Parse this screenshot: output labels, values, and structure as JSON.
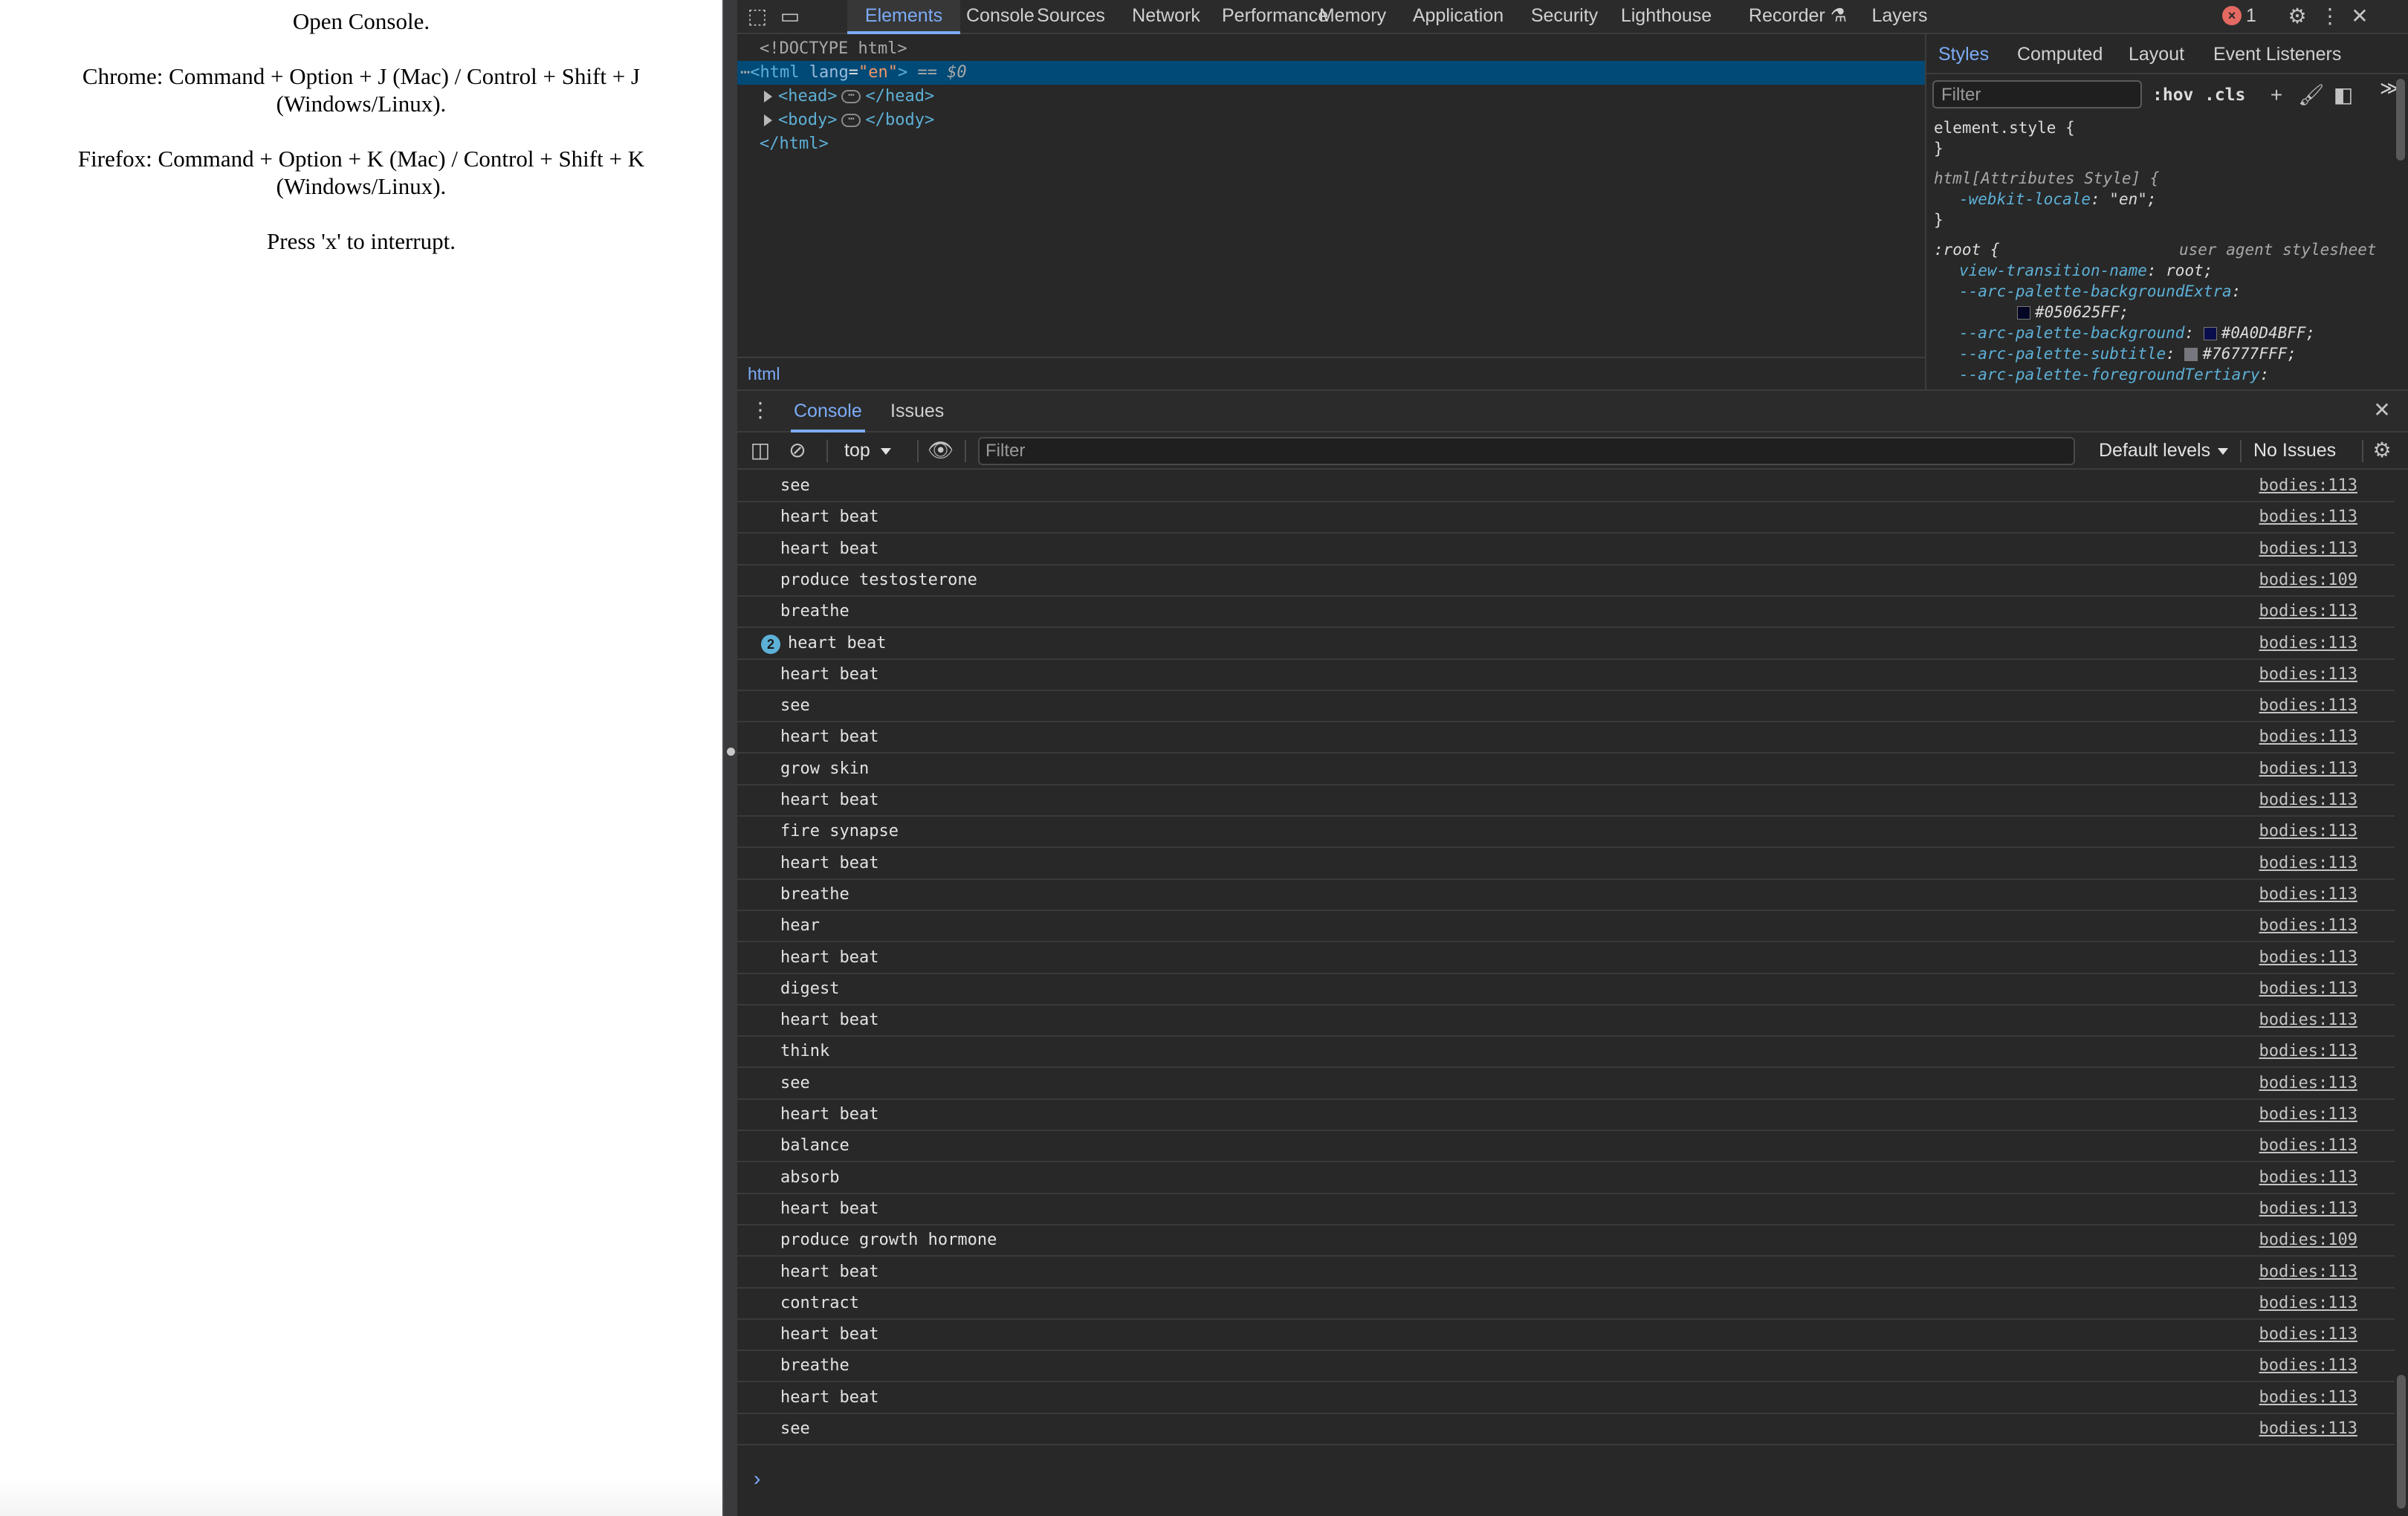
{
  "page": {
    "lines": [
      "Open Console.",
      "Chrome: Command + Option + J (Mac) / Control + Shift + J (Windows/Linux).",
      "Firefox: Command + Option + K (Mac) / Control + Shift + K (Windows/Linux).",
      "Press 'x' to interrupt."
    ]
  },
  "devtools": {
    "main_tabs": [
      {
        "label": "Elements",
        "active": true
      },
      {
        "label": "Console"
      },
      {
        "label": "Sources"
      },
      {
        "label": "Network"
      },
      {
        "label": "Performance"
      },
      {
        "label": "Memory"
      },
      {
        "label": "Application"
      },
      {
        "label": "Security"
      },
      {
        "label": "Lighthouse"
      },
      {
        "label": "Recorder"
      },
      {
        "label": "Layers"
      }
    ],
    "error_count": "1",
    "icons": {
      "inspect": "inspect-element-icon",
      "device": "device-toolbar-icon",
      "settings": "gear-icon",
      "more": "kebab-menu-icon",
      "close": "close-icon",
      "recorder": "flask-icon"
    },
    "dom": {
      "doctype": "<!DOCTYPE html>",
      "html_open_tag": "<html",
      "attr_name": "lang",
      "attr_value": "\"en\"",
      "html_close_bracket": ">",
      "selected_marker": "== $0",
      "head_open": "<head>",
      "head_close": "</head>",
      "body_open": "<body>",
      "body_close": "</body>",
      "html_close": "</html>",
      "ellipsis": "⋯",
      "dots": "⋯"
    },
    "breadcrumb": "html",
    "styles": {
      "tabs": [
        {
          "label": "Styles",
          "active": true
        },
        {
          "label": "Computed"
        },
        {
          "label": "Layout"
        },
        {
          "label": "Event Listeners"
        }
      ],
      "more_tabs": "≫",
      "filter_placeholder": "Filter",
      "hov": ":hov",
      "cls": ".cls",
      "rules": {
        "element_style": "element.style {",
        "close_brace": "}",
        "attr_selector": "html[Attributes Style] {",
        "locale_prop": "-webkit-locale",
        "locale_val": ": \"en\";",
        "root_selector": ":root {",
        "ua_label": "user agent stylesheet",
        "vt_prop": "view-transition-name",
        "vt_val": ": root;",
        "bg_extra_prop": "--arc-palette-backgroundExtra",
        "bg_extra_val": "#050625FF;",
        "bg_extra_color": "#050625",
        "bg_prop": "--arc-palette-background",
        "bg_val": "#0A0D4BFF;",
        "bg_color": "#0A0D4B",
        "subtitle_prop": "--arc-palette-subtitle",
        "subtitle_val": "#76777FFF;",
        "subtitle_color": "#76777F",
        "fg_tertiary_prop": "--arc-palette-foregroundTertiary",
        "colon": ":"
      }
    },
    "drawer": {
      "tabs": [
        {
          "label": "Console",
          "active": true
        },
        {
          "label": "Issues"
        }
      ],
      "context": "top",
      "filter_placeholder": "Filter",
      "levels": "Default levels",
      "no_issues": "No Issues"
    },
    "console_messages": [
      {
        "text": "see",
        "source": "bodies:113"
      },
      {
        "text": "heart beat",
        "source": "bodies:113"
      },
      {
        "text": "heart beat",
        "source": "bodies:113"
      },
      {
        "text": "produce testosterone",
        "source": "bodies:109"
      },
      {
        "text": "breathe",
        "source": "bodies:113"
      },
      {
        "text": "heart beat",
        "source": "bodies:113",
        "count": "2"
      },
      {
        "text": "heart beat",
        "source": "bodies:113"
      },
      {
        "text": "see",
        "source": "bodies:113"
      },
      {
        "text": "heart beat",
        "source": "bodies:113"
      },
      {
        "text": "grow skin",
        "source": "bodies:113"
      },
      {
        "text": "heart beat",
        "source": "bodies:113"
      },
      {
        "text": "fire synapse",
        "source": "bodies:113"
      },
      {
        "text": "heart beat",
        "source": "bodies:113"
      },
      {
        "text": "breathe",
        "source": "bodies:113"
      },
      {
        "text": "hear",
        "source": "bodies:113"
      },
      {
        "text": "heart beat",
        "source": "bodies:113"
      },
      {
        "text": "digest",
        "source": "bodies:113"
      },
      {
        "text": "heart beat",
        "source": "bodies:113"
      },
      {
        "text": "think",
        "source": "bodies:113"
      },
      {
        "text": "see",
        "source": "bodies:113"
      },
      {
        "text": "heart beat",
        "source": "bodies:113"
      },
      {
        "text": "balance",
        "source": "bodies:113"
      },
      {
        "text": "absorb",
        "source": "bodies:113"
      },
      {
        "text": "heart beat",
        "source": "bodies:113"
      },
      {
        "text": "produce growth hormone",
        "source": "bodies:109"
      },
      {
        "text": "heart beat",
        "source": "bodies:113"
      },
      {
        "text": "contract",
        "source": "bodies:113"
      },
      {
        "text": "heart beat",
        "source": "bodies:113"
      },
      {
        "text": "breathe",
        "source": "bodies:113"
      },
      {
        "text": "heart beat",
        "source": "bodies:113"
      },
      {
        "text": "see",
        "source": "bodies:113"
      }
    ],
    "prompt": "›"
  }
}
